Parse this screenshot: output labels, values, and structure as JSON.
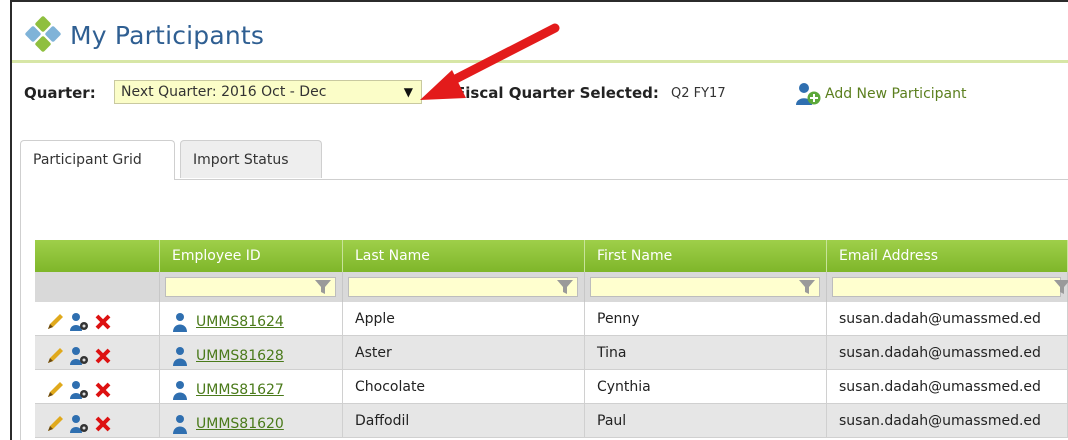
{
  "header": {
    "title": "My Participants"
  },
  "toolbar": {
    "quarter_label": "Quarter:",
    "quarter_selected": "Next Quarter: 2016 Oct - Dec",
    "fiscal_label": "Fiscal Quarter Selected:",
    "fiscal_value": "Q2 FY17",
    "add_participant_label": "Add New Participant"
  },
  "tabs": [
    {
      "label": "Participant Grid",
      "active": true
    },
    {
      "label": "Import Status",
      "active": false
    }
  ],
  "grid": {
    "columns": [
      "",
      "Employee ID",
      "Last Name",
      "First Name",
      "Email Address"
    ],
    "rows": [
      {
        "employee_id": "UMMS81624",
        "last_name": "Apple",
        "first_name": "Penny",
        "email": "susan.dadah@umassmed.ed"
      },
      {
        "employee_id": "UMMS81628",
        "last_name": "Aster",
        "first_name": "Tina",
        "email": "susan.dadah@umassmed.ed"
      },
      {
        "employee_id": "UMMS81627",
        "last_name": "Chocolate",
        "first_name": "Cynthia",
        "email": "susan.dadah@umassmed.ed"
      },
      {
        "employee_id": "UMMS81620",
        "last_name": "Daffodil",
        "first_name": "Paul",
        "email": "susan.dadah@umassmed.ed"
      }
    ]
  },
  "colors": {
    "accent_green": "#8fbf3f",
    "title_blue": "#2f5f92",
    "link_green": "#4a7a1a",
    "annotation_red": "#e31b1b"
  }
}
